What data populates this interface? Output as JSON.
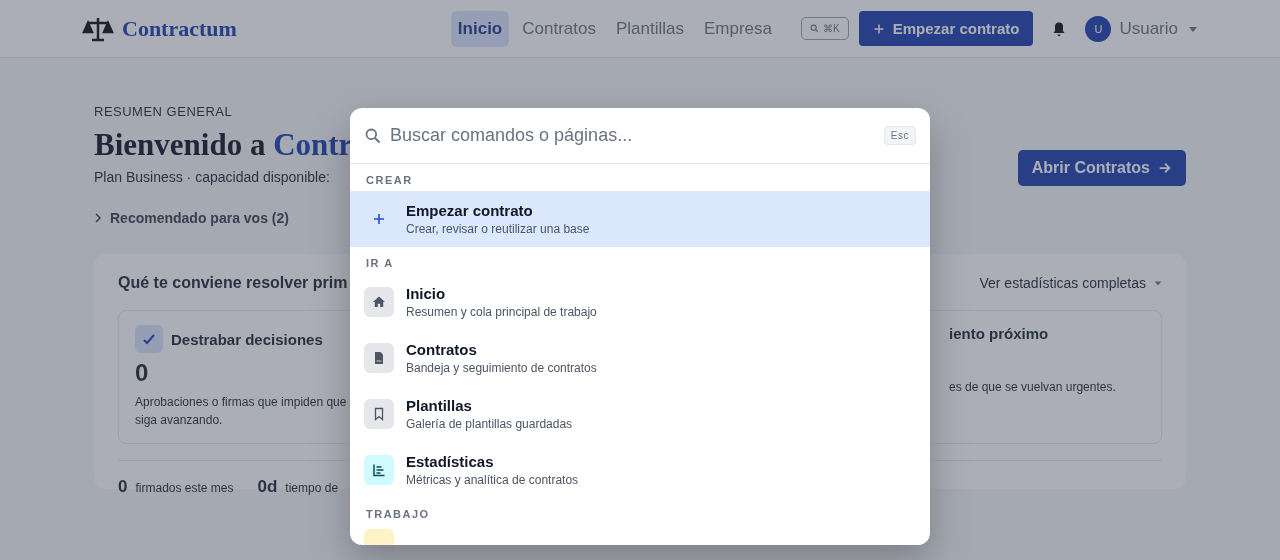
{
  "header": {
    "logo": "Contractum",
    "nav": [
      {
        "label": "Inicio",
        "selected": true
      },
      {
        "label": "Contratos",
        "selected": false
      },
      {
        "label": "Plantillas",
        "selected": false
      },
      {
        "label": "Empresa",
        "selected": false
      }
    ],
    "search_shortcut": "⌘K",
    "primary_button": "Empezar contrato",
    "avatar_initial": "U",
    "user": "Usuario"
  },
  "page": {
    "eyebrow": "RESUMEN GENERAL",
    "title": "Bienvenido a",
    "title_accent": "Contr",
    "subtitle": "Plan Business · capacidad disponible:",
    "open_button": "Abrir Contratos",
    "recommended": "Recomendado para vos (2)",
    "panel": {
      "title": "Qué te conviene resolver prim",
      "link": "Ver estadísticas completas",
      "cards": [
        {
          "title": "Destrabar decisiones",
          "value": "0",
          "text": "Aprobaciones o firmas que impiden que siga avanzando."
        },
        {
          "title": "iento próximo",
          "text": "es de que se vuelvan urgentes."
        }
      ],
      "stats": [
        {
          "value": "0",
          "label": "firmados este mes"
        },
        {
          "value": "0d",
          "label": "tiempo de"
        }
      ]
    }
  },
  "palette": {
    "placeholder": "Buscar comandos o páginas...",
    "esc": "Esc",
    "sections": [
      {
        "label": "CREAR",
        "items": [
          {
            "kind": "plus",
            "title": "Empezar contrato",
            "subtitle": "Crear, revisar o reutilizar una base",
            "selected": true
          }
        ]
      },
      {
        "label": "IR A",
        "items": [
          {
            "kind": "home",
            "title": "Inicio",
            "subtitle": "Resumen y cola principal de trabajo",
            "selected": false
          },
          {
            "kind": "document",
            "title": "Contratos",
            "subtitle": "Bandeja y seguimiento de contratos",
            "selected": false
          },
          {
            "kind": "bookmark",
            "title": "Plantillas",
            "subtitle": "Galería de plantillas guardadas",
            "selected": false
          },
          {
            "kind": "chart",
            "title": "Estadísticas",
            "subtitle": "Métricas y analítica de contratos",
            "selected": false
          }
        ]
      },
      {
        "label": "TRABAJO"
      }
    ]
  }
}
